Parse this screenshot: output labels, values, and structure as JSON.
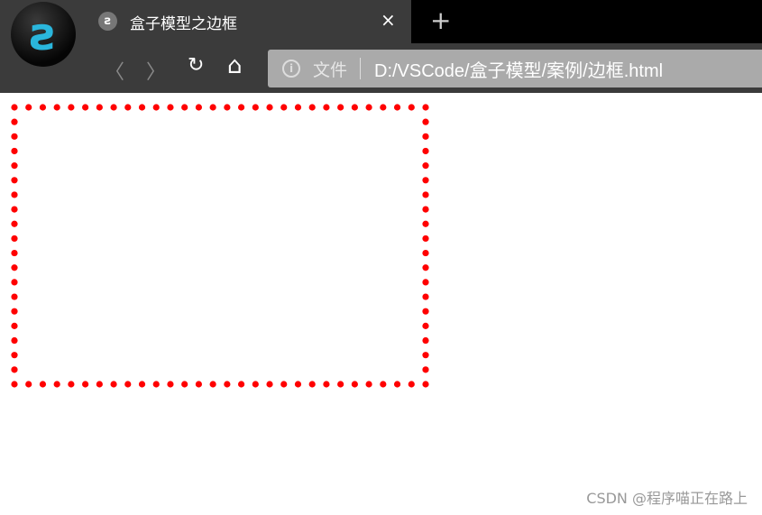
{
  "tab": {
    "title": "盒子模型之边框",
    "close": "×",
    "new_tab": "+",
    "favicon": "ƨ"
  },
  "logo": {
    "glyph": "ƨ"
  },
  "nav": {
    "back": "〈",
    "forward": "〉",
    "reload": "↻",
    "home": "⌂"
  },
  "address": {
    "scheme_label": "文件",
    "info": "i",
    "url": "D:/VSCode/盒子模型/案例/边框.html"
  },
  "page": {
    "box_border": {
      "style": "dotted",
      "color": "#ff0000"
    }
  },
  "watermark": "CSDN @程序喵正在路上"
}
